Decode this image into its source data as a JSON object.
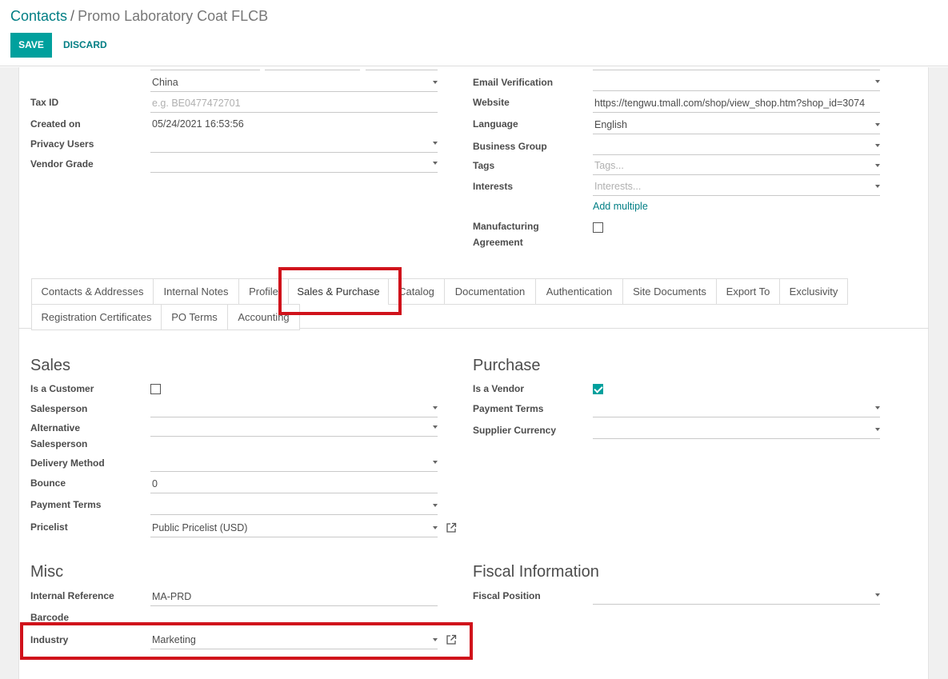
{
  "breadcrumb": {
    "parent": "Contacts",
    "separator": "/",
    "current": "Promo Laboratory Coat FLCB"
  },
  "buttons": {
    "save": "SAVE",
    "discard": "DISCARD"
  },
  "left_fields": {
    "country_value": "China",
    "tax_id_label": "Tax ID",
    "tax_id_placeholder": "e.g. BE0477472701",
    "created_on_label": "Created on",
    "created_on_value": "05/24/2021 16:53:56",
    "privacy_users_label": "Privacy Users",
    "vendor_grade_label": "Vendor Grade"
  },
  "right_fields": {
    "email_verification_label": "Email Verification",
    "website_label": "Website",
    "website_value": "https://tengwu.tmall.com/shop/view_shop.htm?shop_id=3074",
    "language_label": "Language",
    "language_value": "English",
    "business_group_label": "Business Group",
    "tags_label": "Tags",
    "tags_placeholder": "Tags...",
    "interests_label": "Interests",
    "interests_placeholder": "Interests...",
    "add_multiple": "Add multiple",
    "manufacturing_label_1": "Manufacturing",
    "manufacturing_label_2": "Agreement"
  },
  "tabs": [
    "Contacts & Addresses",
    "Internal Notes",
    "Profile",
    "Sales & Purchase",
    "Catalog",
    "Documentation",
    "Authentication",
    "Site Documents",
    "Export To",
    "Exclusivity",
    "Registration Certificates",
    "PO Terms",
    "Accounting"
  ],
  "active_tab": "Sales & Purchase",
  "sales": {
    "title": "Sales",
    "is_customer_label": "Is a Customer",
    "is_customer": false,
    "salesperson_label": "Salesperson",
    "alt_salesperson_label_1": "Alternative",
    "alt_salesperson_label_2": "Salesperson",
    "delivery_method_label": "Delivery Method",
    "bounce_label": "Bounce",
    "bounce_value": "0",
    "payment_terms_label": "Payment Terms",
    "pricelist_label": "Pricelist",
    "pricelist_value": "Public Pricelist (USD)"
  },
  "purchase": {
    "title": "Purchase",
    "is_vendor_label": "Is a Vendor",
    "is_vendor": true,
    "payment_terms_label": "Payment Terms",
    "supplier_currency_label": "Supplier Currency"
  },
  "misc": {
    "title": "Misc",
    "internal_reference_label": "Internal Reference",
    "internal_reference_value": "MA-PRD",
    "barcode_label": "Barcode",
    "industry_label": "Industry",
    "industry_value": "Marketing"
  },
  "fiscal": {
    "title": "Fiscal Information",
    "fiscal_position_label": "Fiscal Position"
  },
  "colors": {
    "accent": "#00a09d",
    "link": "#017e84",
    "highlight": "#d0121b"
  }
}
